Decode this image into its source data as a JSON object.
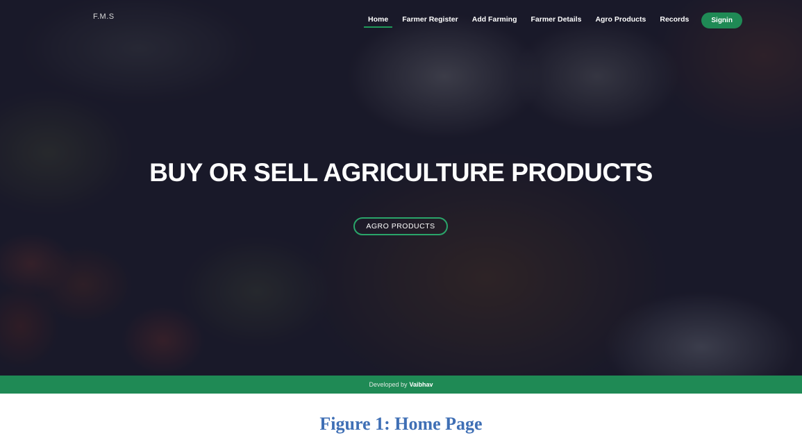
{
  "header": {
    "brand": "F.M.S",
    "nav": {
      "home": "Home",
      "farmer_register": "Farmer Register",
      "add_farming": "Add Farming",
      "farmer_details": "Farmer Details",
      "agro_products": "Agro Products",
      "records": "Records"
    },
    "signin_label": "Signin"
  },
  "hero": {
    "headline": "BUY OR SELL AGRICULTURE PRODUCTS",
    "cta_label": "AGRO PRODUCTS"
  },
  "footer": {
    "developed_by": "Developed by",
    "author": "Vaibhav"
  },
  "caption": "Figure 1: Home Page",
  "colors": {
    "accent_green": "#1f8a55",
    "caption_blue": "#3f6fb5"
  }
}
